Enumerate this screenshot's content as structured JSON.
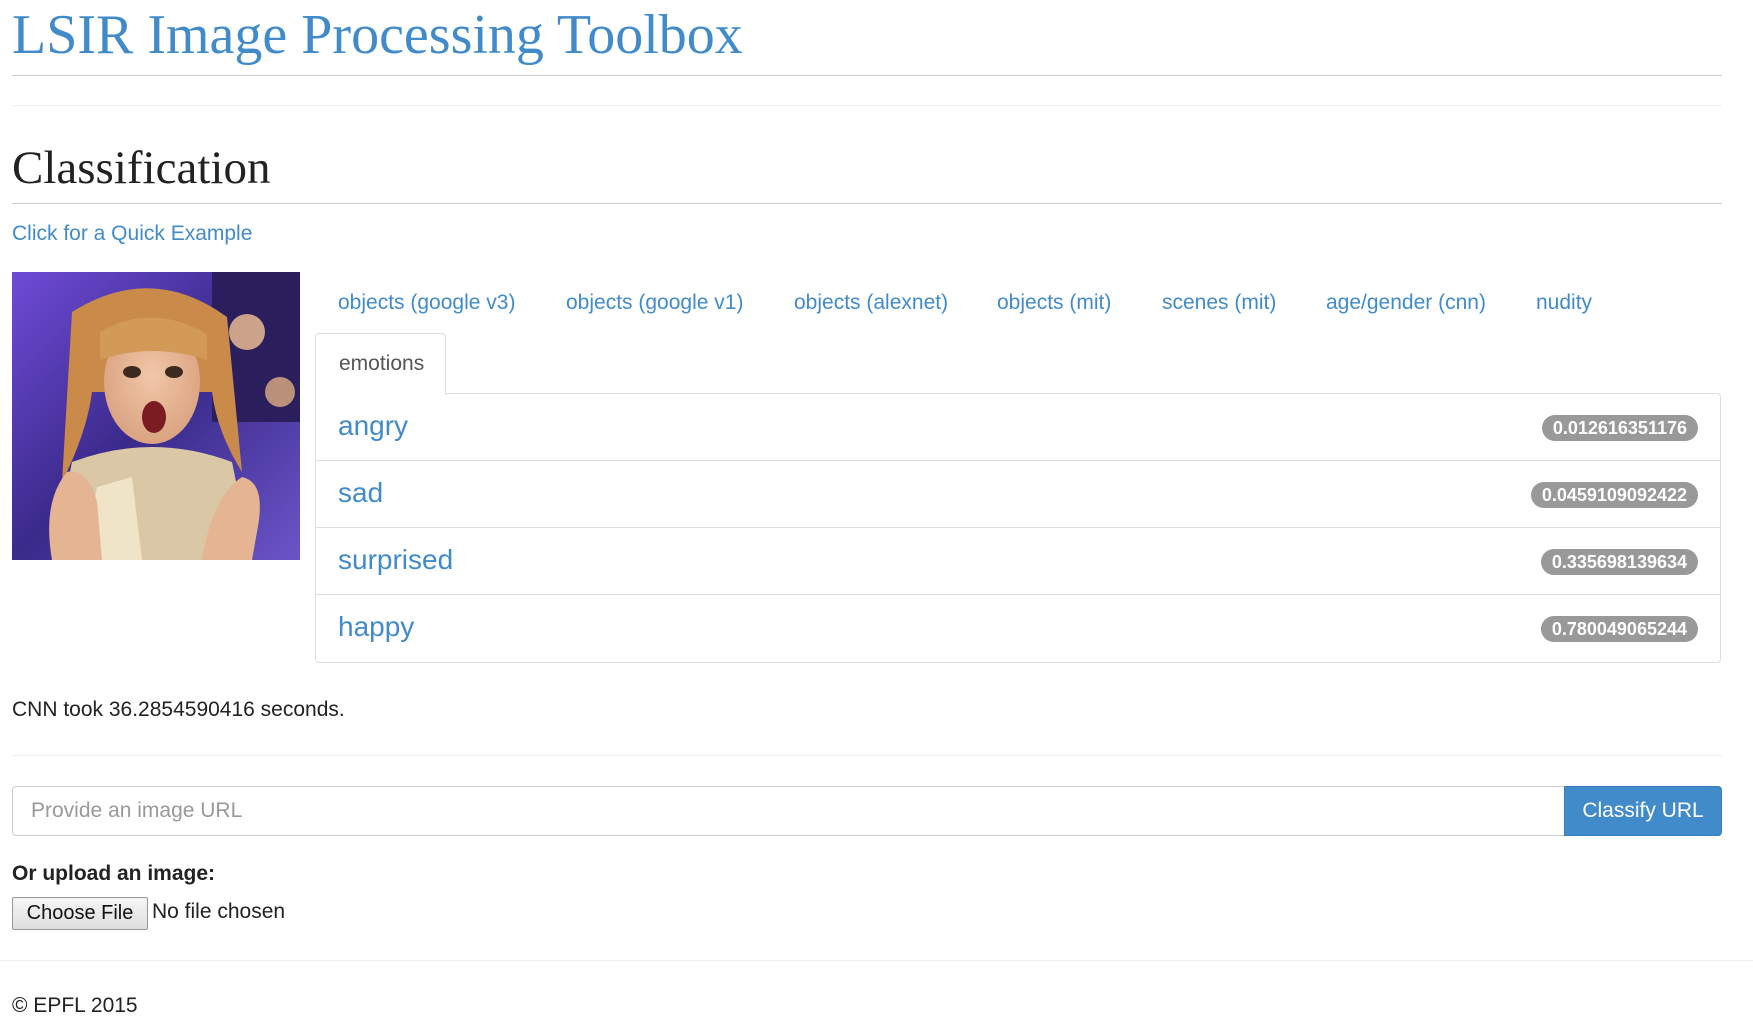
{
  "header": {
    "title": "LSIR Image Processing Toolbox"
  },
  "section": {
    "title": "Classification",
    "quick_example_link": "Click for a Quick Example"
  },
  "tabs": [
    {
      "label": "objects (google v3)"
    },
    {
      "label": "objects (google v1)"
    },
    {
      "label": "objects (alexnet)"
    },
    {
      "label": "objects (mit)"
    },
    {
      "label": "scenes (mit)"
    },
    {
      "label": "age/gender (cnn)"
    },
    {
      "label": "nudity"
    },
    {
      "label": "emotions",
      "active": true
    }
  ],
  "results": [
    {
      "label": "angry",
      "score": "0.012616351176"
    },
    {
      "label": "sad",
      "score": "0.0459109092422"
    },
    {
      "label": "surprised",
      "score": "0.335698139634"
    },
    {
      "label": "happy",
      "score": "0.780049065244"
    }
  ],
  "timing": "CNN took 36.2854590416 seconds.",
  "url_form": {
    "placeholder": "Provide an image URL",
    "value": "",
    "button_label": "Classify URL"
  },
  "upload": {
    "label": "Or upload an image:",
    "button_label": "Choose File",
    "status": "No file chosen"
  },
  "footer": {
    "copyright": "© EPFL 2015"
  },
  "colors": {
    "link": "#428bca",
    "primary_button": "#428bca",
    "badge": "#999999",
    "text": "#333333"
  }
}
